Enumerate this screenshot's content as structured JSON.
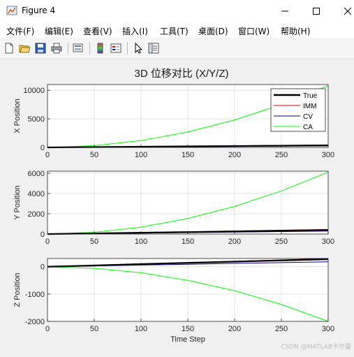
{
  "window": {
    "title": "Figure 4"
  },
  "menu": {
    "items": [
      {
        "label": "文件(F)"
      },
      {
        "label": "编辑(E)"
      },
      {
        "label": "查看(V)"
      },
      {
        "label": "插入(I)"
      },
      {
        "label": "工具(T)"
      },
      {
        "label": "桌面(D)"
      },
      {
        "label": "窗口(W)"
      },
      {
        "label": "帮助(H)"
      }
    ]
  },
  "toolbar": {
    "icons": [
      "new-figure-icon",
      "open-file-icon",
      "save-icon",
      "print-icon",
      "print-preview-icon",
      "colorbar-icon",
      "legend-icon",
      "edit-plot-icon",
      "property-inspector-icon"
    ]
  },
  "figure": {
    "title": "3D 位移对比 (X/Y/Z)",
    "colors": {
      "True": "#000000",
      "IMM": "#d40000",
      "CV": "#00008b",
      "CA": "#00ff00",
      "grid": "#dcdcdc",
      "axes_bg": "#ffffff"
    }
  },
  "chart_data": [
    {
      "type": "line",
      "ylabel": "X Position",
      "xlabel": "",
      "xlim": [
        0,
        300
      ],
      "ylim": [
        0,
        11000
      ],
      "xticks": [
        0,
        50,
        100,
        150,
        200,
        250,
        300
      ],
      "yticks": [
        0,
        5000,
        10000
      ],
      "grid": true,
      "legend": {
        "position": "top-right",
        "entries": [
          "True",
          "IMM",
          "CV",
          "CA"
        ]
      },
      "x": [
        0,
        50,
        100,
        150,
        200,
        250,
        300
      ],
      "series": [
        {
          "name": "True",
          "values": [
            0,
            60,
            120,
            180,
            240,
            300,
            360
          ]
        },
        {
          "name": "IMM",
          "values": [
            0,
            70,
            140,
            215,
            290,
            370,
            450
          ]
        },
        {
          "name": "CV",
          "values": [
            0,
            40,
            80,
            125,
            170,
            215,
            260
          ]
        },
        {
          "name": "CA",
          "values": [
            0,
            300,
            1200,
            2700,
            4800,
            7500,
            10800
          ]
        }
      ]
    },
    {
      "type": "line",
      "ylabel": "Y Position",
      "xlabel": "",
      "xlim": [
        0,
        300
      ],
      "ylim": [
        0,
        6200
      ],
      "xticks": [
        0,
        50,
        100,
        150,
        200,
        250,
        300
      ],
      "yticks": [
        0,
        2000,
        4000,
        6000
      ],
      "grid": true,
      "x": [
        0,
        50,
        100,
        150,
        200,
        250,
        300
      ],
      "series": [
        {
          "name": "True",
          "values": [
            0,
            65,
            130,
            195,
            260,
            330,
            400
          ]
        },
        {
          "name": "IMM",
          "values": [
            0,
            75,
            150,
            225,
            300,
            380,
            460
          ]
        },
        {
          "name": "CV",
          "values": [
            0,
            45,
            90,
            140,
            190,
            240,
            290
          ]
        },
        {
          "name": "CA",
          "values": [
            0,
            170,
            680,
            1530,
            2720,
            4250,
            6100
          ]
        }
      ]
    },
    {
      "type": "line",
      "ylabel": "Z Position",
      "xlabel": "Time Step",
      "xlim": [
        0,
        300
      ],
      "ylim": [
        -2000,
        300
      ],
      "xticks": [
        0,
        50,
        100,
        150,
        200,
        250,
        300
      ],
      "yticks": [
        -2000,
        -1000,
        0
      ],
      "grid": true,
      "x": [
        0,
        50,
        100,
        150,
        200,
        250,
        300
      ],
      "series": [
        {
          "name": "True",
          "values": [
            0,
            45,
            95,
            140,
            185,
            230,
            275
          ]
        },
        {
          "name": "IMM",
          "values": [
            0,
            50,
            100,
            150,
            200,
            250,
            300
          ]
        },
        {
          "name": "CV",
          "values": [
            0,
            30,
            60,
            90,
            120,
            150,
            180
          ]
        },
        {
          "name": "CA",
          "values": [
            0,
            -60,
            -220,
            -500,
            -880,
            -1380,
            -2000
          ]
        }
      ]
    }
  ],
  "watermark": "CSDN @MATLAB卡尔曼"
}
